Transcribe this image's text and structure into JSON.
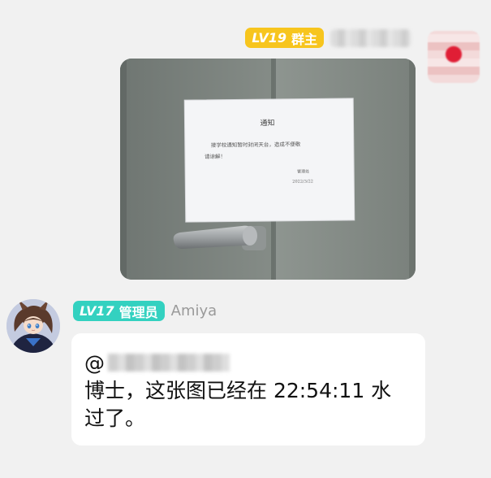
{
  "top_message": {
    "level": "LV19",
    "role": "群主",
    "colors": {
      "badge": "#f7c51d"
    },
    "photo": {
      "notice_title": "通知",
      "notice_line1": "接学校通知暂时封闭天台，造成不便敬",
      "notice_line2": "请谅解！",
      "notice_signoff": "管理处",
      "notice_date": "2022/3/22"
    }
  },
  "second_message": {
    "level": "LV17",
    "role": "管理员",
    "sender": "Amiya",
    "mention_prefix": "@",
    "text": "博士，这张图已经在 22:54:11 水\n过了。",
    "colors": {
      "badge": "#33d1c0"
    }
  }
}
